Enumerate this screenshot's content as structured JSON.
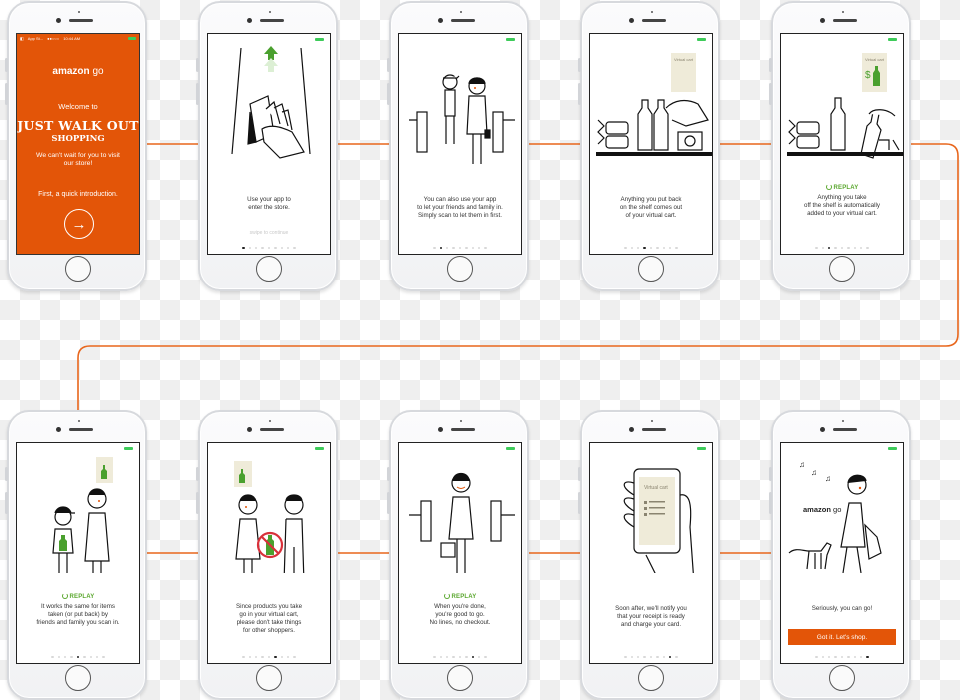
{
  "colors": {
    "brand_orange": "#e35508",
    "replay_green": "#5aa72e",
    "battery_green": "#3ecb5a",
    "connector": "#e8661c",
    "receipt_paper": "#efebd9"
  },
  "status_bar": {
    "carrier": "App St...",
    "signal": "●●○○○",
    "wifi_icon": "wifi-icon",
    "time": "10:44 AM"
  },
  "replay_label": "REPLAY",
  "page_count": 9,
  "screens": [
    {
      "id": "welcome",
      "logo_primary": "amazon",
      "logo_secondary": "go",
      "welcome": "Welcome to",
      "title": "JUST WALK OUT",
      "subtitle": "SHOPPING",
      "text": "We can't wait for you to visit\nour store!",
      "intro": "First, a quick introduction.",
      "next_icon": "arrow-right-icon"
    },
    {
      "id": "enter-store",
      "illustration": "hand-scanning-phone-at-gate",
      "caption": "Use your app to\nenter the store.",
      "swipe_hint": "swipe to continue",
      "active_dot": 1
    },
    {
      "id": "friends-family",
      "illustration": "family-passing-turnstile",
      "caption": "You can also use your app\nto let your friends and family in.\nSimply scan to let them in first.",
      "active_dot": 2
    },
    {
      "id": "put-back",
      "illustration": "hand-returning-bottle-to-shelf",
      "receipt_title": "Virtual cart",
      "caption": "Anything you put back\non the shelf comes out\nof your virtual cart.",
      "active_dot": 4
    },
    {
      "id": "take-item",
      "illustration": "hand-taking-bottle-from-shelf",
      "receipt_title": "Virtual cart",
      "receipt_price": "$",
      "replay": true,
      "caption": "Anything you take\noff the shelf is automatically\nadded to your virtual cart.",
      "active_dot": 3
    },
    {
      "id": "shared-cart",
      "illustration": "child-and-parent-with-bottle",
      "replay": true,
      "caption": "It works the same for items\ntaken (or put back) by\nfriends and family you scan in.",
      "active_dot": 5
    },
    {
      "id": "dont-take-others",
      "illustration": "no-passing-bottle",
      "caption": "Since products you take\ngo in your virtual cart,\nplease don't take things\nfor other shoppers.",
      "active_dot": 6
    },
    {
      "id": "done",
      "illustration": "shopper-exiting-turnstile",
      "replay": true,
      "caption": "When you're done,\nyou're good to go.\nNo lines, no checkout.",
      "active_dot": 7
    },
    {
      "id": "receipt",
      "illustration": "hand-holding-phone-receipt",
      "receipt_title": "Virtual cart",
      "caption": "Soon after, we'll notify you\nthat your receipt is ready\nand charge your card.",
      "active_dot": 8
    },
    {
      "id": "finish",
      "illustration": "woman-walking-dog",
      "logo_primary": "amazon",
      "logo_secondary": "go",
      "caption": "Seriously, you can go!",
      "button_label": "Got it. Let's shop.",
      "active_dot": 9
    }
  ]
}
